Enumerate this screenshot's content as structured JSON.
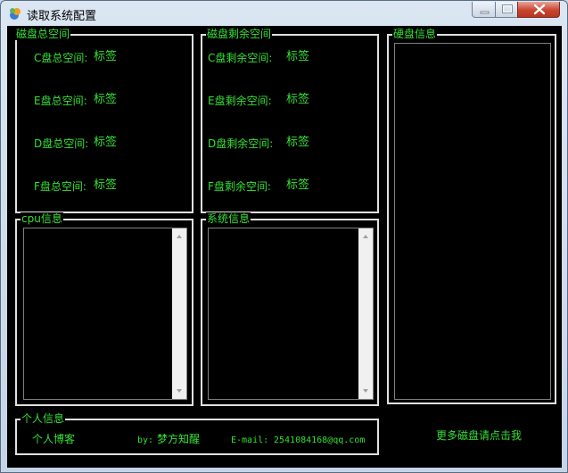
{
  "window": {
    "title": "读取系统配置"
  },
  "total_space": {
    "title": "磁盘总空间",
    "rows": [
      {
        "label": "C盘总空间:",
        "value": "标签"
      },
      {
        "label": "E盘总空间:",
        "value": "标签"
      },
      {
        "label": "D盘总空间:",
        "value": "标签"
      },
      {
        "label": "F盘总空间:",
        "value": "标签"
      }
    ]
  },
  "free_space": {
    "title": "磁盘剩余空间",
    "rows": [
      {
        "label": "C盘剩余空间:",
        "value": "标签"
      },
      {
        "label": "E盘剩余空间:",
        "value": "标签"
      },
      {
        "label": "D盘剩余空间:",
        "value": "标签"
      },
      {
        "label": "F盘剩余空间:",
        "value": "标签"
      }
    ]
  },
  "disk_info": {
    "title": "硬盘信息"
  },
  "cpu_info": {
    "title": "cpu信息"
  },
  "system_info": {
    "title": "系统信息"
  },
  "personal": {
    "title": "个人信息",
    "blog_link": "个人博客",
    "by_label": "by:",
    "author": "梦方知醒",
    "email_label": "E-mail:",
    "email": "2541084168@qq.com"
  },
  "more_disks_link": "更多磁盘请点击我",
  "colors": {
    "text": "#35e035",
    "background": "#000000",
    "frame": "#e0e0e0"
  }
}
